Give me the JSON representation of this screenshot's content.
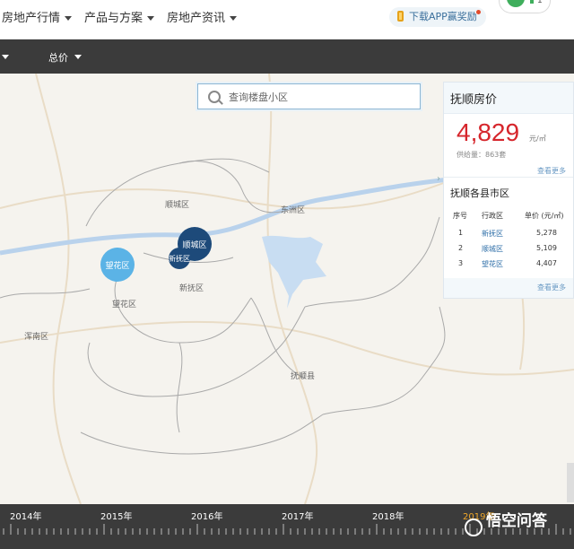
{
  "nav": {
    "items": [
      "房地产行情",
      "产品与方案",
      "房地产资讯"
    ],
    "app_download": "下载APP赢奖励",
    "badge_count": "1"
  },
  "filter": {
    "total_price": "总价"
  },
  "search": {
    "placeholder": "查询楼盘小区"
  },
  "map": {
    "places": [
      "顺城区",
      "东洲区",
      "新抚区",
      "望花区",
      "浑南区",
      "抚顺县"
    ],
    "clusters": [
      "顺城区",
      "新抚区",
      "望花区"
    ]
  },
  "panel": {
    "title": "抚顺房价",
    "price": "4,829",
    "unit": "元/㎡",
    "supply": "供给量：863套",
    "see_more": "查看更多",
    "county_title": "抚顺各县市区",
    "headers": [
      "序号",
      "行政区",
      "单价 (元/㎡)"
    ],
    "rows": [
      {
        "no": "1",
        "district": "新抚区",
        "price": "5,278"
      },
      {
        "no": "2",
        "district": "顺城区",
        "price": "5,109"
      },
      {
        "no": "3",
        "district": "望花区",
        "price": "4,407"
      }
    ],
    "see_more_2": "查看更多"
  },
  "timeline": {
    "years": [
      "2014年",
      "2015年",
      "2016年",
      "2017年",
      "2018年",
      "2019年"
    ],
    "active_year": "2019年"
  },
  "watermark": "悟空问答",
  "colors": {
    "accent": "#d6262c",
    "link": "#2f6fa8",
    "active_year": "#f0a829",
    "cluster_dark": "#1d4a7a",
    "cluster_light": "#5bb3e6"
  }
}
